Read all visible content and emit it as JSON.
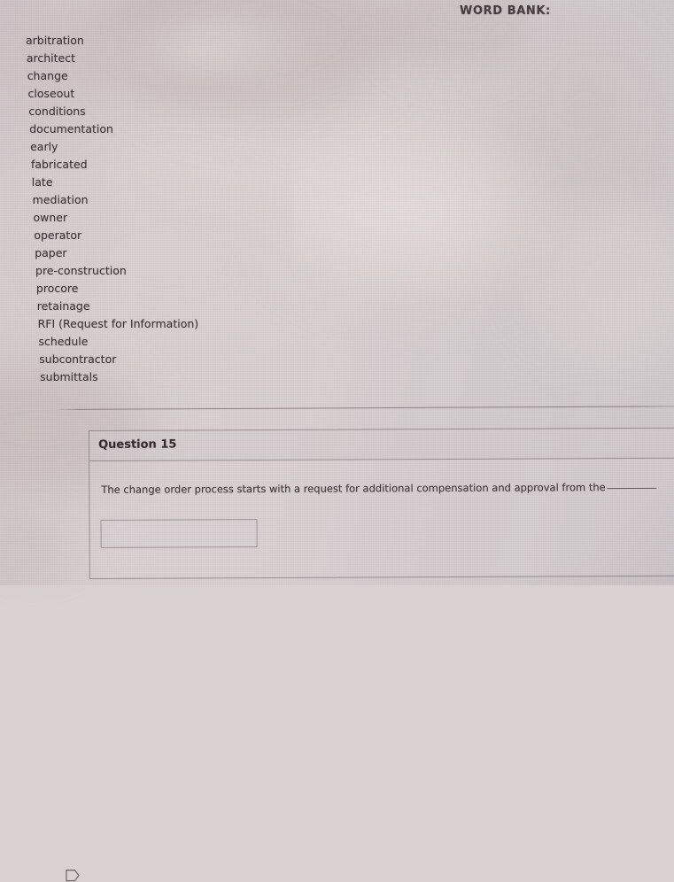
{
  "word_bank": {
    "title": "WORD BANK:",
    "items": [
      "arbitration",
      "architect",
      "change",
      "closeout",
      "conditions",
      "documentation",
      "early",
      "fabricated",
      "late",
      "mediation",
      "owner",
      "operator",
      "paper",
      "pre-construction",
      "procore",
      "retainage",
      "RFI (Request for Information)",
      "schedule",
      "subcontractor",
      "submittals"
    ]
  },
  "question": {
    "flag_icon": "flag-outline-icon",
    "header_label": "Question 15",
    "text_before_blank": "The change order process starts with a request for additional compensation and approval from the",
    "blank": "_______",
    "answer_value": "",
    "answer_placeholder": ""
  },
  "colors": {
    "page_background": "#d8cfd0",
    "text": "#3a3033",
    "border": "#70636 8",
    "card_header": "#cdc5c8"
  }
}
